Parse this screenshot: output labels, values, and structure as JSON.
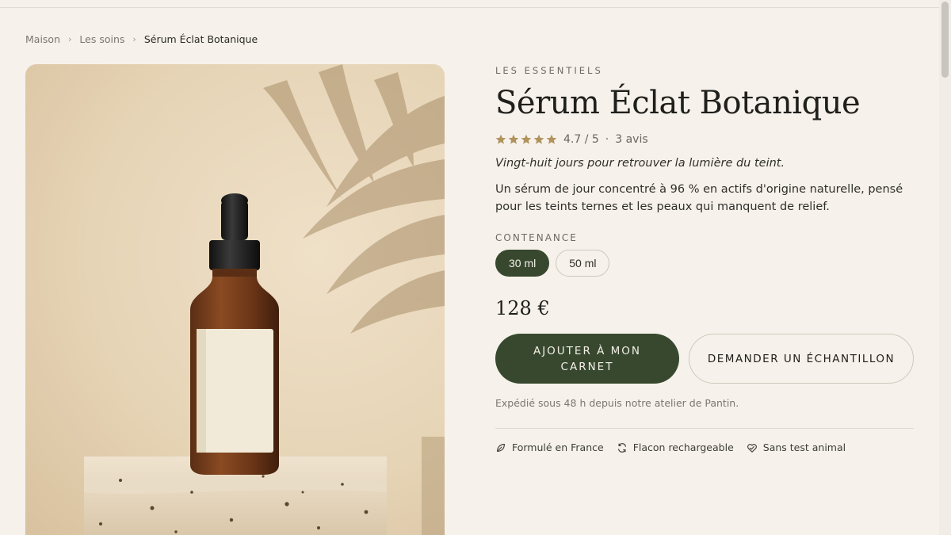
{
  "breadcrumb": {
    "home": "Maison",
    "category": "Les soins",
    "current": "Sérum Éclat Botanique",
    "separator": "›"
  },
  "gallery": {
    "image_description_icon": "product-photo-serum-bottle"
  },
  "product": {
    "eyebrow": "LES ESSENTIELS",
    "title": "Sérum Éclat Botanique",
    "rating": {
      "stars": 5,
      "score": "4.7 / 5",
      "separator": "·",
      "reviews": "3 avis"
    },
    "tagline": "Vingt-huit jours pour retrouver la lumière du teint.",
    "description": "Un sérum de jour concentré à 96 % en actifs d'origine naturelle, pensé pour les teints ternes et les peaux qui manquent de relief.",
    "size_label": "CONTENANCE",
    "sizes": [
      "30 ml",
      "50 ml"
    ],
    "selected_size": "30 ml",
    "price": "128 €",
    "primary_cta": "AJOUTER À MON CARNET",
    "secondary_cta": "DEMANDER UN ÉCHANTILLON",
    "shipping": "Expédié sous 48 h depuis notre atelier de Pantin.",
    "features": [
      {
        "label": "Formulé en France",
        "icon": "leaf-icon"
      },
      {
        "label": "Flacon rechargeable",
        "icon": "refresh-icon"
      },
      {
        "label": "Sans test animal",
        "icon": "heart-icon"
      }
    ]
  },
  "colors": {
    "background": "#f6f1ea",
    "accent": "#37482f",
    "star": "#b0935c"
  }
}
